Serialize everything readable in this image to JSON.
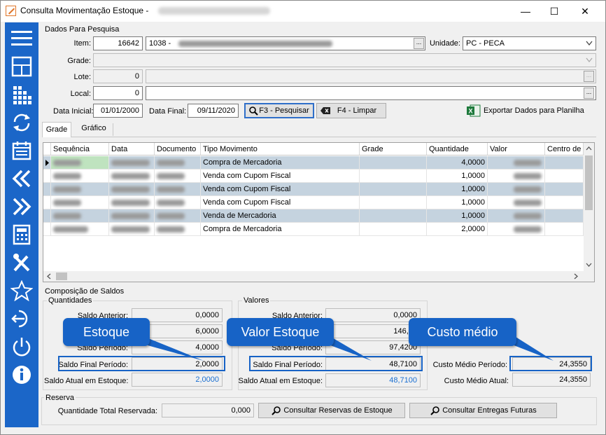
{
  "window": {
    "title": "Consulta Movimentação Estoque  -",
    "min": "—",
    "max": "☐",
    "close": "✕"
  },
  "filters": {
    "section_title": "Dados Para Pesquisa",
    "item_label": "Item:",
    "item_code": "16642",
    "item_desc": "1038 -",
    "unidade_label": "Unidade:",
    "unidade_value": "PC - PECA",
    "grade_label": "Grade:",
    "lote_label": "Lote:",
    "lote_value": "0",
    "local_label": "Local:",
    "local_value": "0",
    "data_inicial_label": "Data Inicial:",
    "data_inicial": "01/01/2000",
    "data_final_label": "Data Final:",
    "data_final": "09/11/2020",
    "pesquisar_btn": "F3 - Pesquisar",
    "limpar_btn": "F4 - Limpar",
    "exportar_btn": "Exportar Dados para Planilha",
    "dots": "..."
  },
  "tabs": [
    "Grade",
    "Gráfico"
  ],
  "grid": {
    "headers": [
      "Sequência",
      "Data",
      "Documento",
      "Tipo Movimento",
      "Grade",
      "Quantidade",
      "Valor",
      "Centro de C"
    ],
    "rows": [
      {
        "tipo": "Compra de Mercadoria",
        "quantidade": "4,0000"
      },
      {
        "tipo": "Venda com Cupom Fiscal",
        "quantidade": "1,0000"
      },
      {
        "tipo": "Venda com Cupom Fiscal",
        "quantidade": "1,0000"
      },
      {
        "tipo": "Venda com Cupom Fiscal",
        "quantidade": "1,0000"
      },
      {
        "tipo": "Venda de Mercadoria",
        "quantidade": "1,0000"
      },
      {
        "tipo": "Compra de Mercadoria",
        "quantidade": "2,0000"
      }
    ]
  },
  "saldos": {
    "section_title": "Composição de Saldos",
    "quantidades": {
      "title": "Quantidades",
      "saldo_anterior_label": "Saldo Anterior:",
      "saldo_anterior": "0,0000",
      "entradas": "6,0000",
      "saldo_periodo_label": "Saldo Período:",
      "saldo_periodo": "4,0000",
      "saldo_final_label": "Saldo Final Período:",
      "saldo_final": "2,0000",
      "saldo_atual_label": "Saldo Atual em Estoque:",
      "saldo_atual": "2,0000"
    },
    "valores": {
      "title": "Valores",
      "saldo_anterior_label": "Saldo Anterior:",
      "saldo_anterior": "0,0000",
      "entradas": "146,13",
      "saldo_periodo_label": "Saldo Período:",
      "saldo_periodo": "97,4200",
      "saldo_final_label": "Saldo Final Período:",
      "saldo_final": "48,7100",
      "saldo_atual_label": "Saldo Atual em Estoque:",
      "saldo_atual": "48,7100"
    },
    "custo": {
      "medio_periodo_label": "Custo Médio Período:",
      "medio_periodo": "24,3550",
      "medio_atual_label": "Custo Médio Atual:",
      "medio_atual": "24,3550"
    }
  },
  "reserva": {
    "section_title": "Reserva",
    "qtd_label": "Quantidade Total Reservada:",
    "qtd_value": "0,000",
    "consultar_reservas_btn": "Consultar Reservas de Estoque",
    "consultar_entregas_btn": "Consultar Entregas Futuras"
  },
  "callouts": {
    "estoque": "Estoque",
    "valor_estoque": "Valor Estoque",
    "custo_medio": "Custo médio"
  },
  "colors": {
    "sidebar": "#1b66c8",
    "callout": "#1763c6",
    "selected_row": "#c5d3df",
    "link_value": "#1a6fd1"
  },
  "sidebar_icons": [
    "menu-icon",
    "layout-icon",
    "grid-icon",
    "refresh-icon",
    "calendar-icon",
    "double-left-icon",
    "double-right-icon",
    "calculator-icon",
    "tools-icon",
    "star-icon",
    "exit-icon",
    "power-icon",
    "info-icon"
  ]
}
